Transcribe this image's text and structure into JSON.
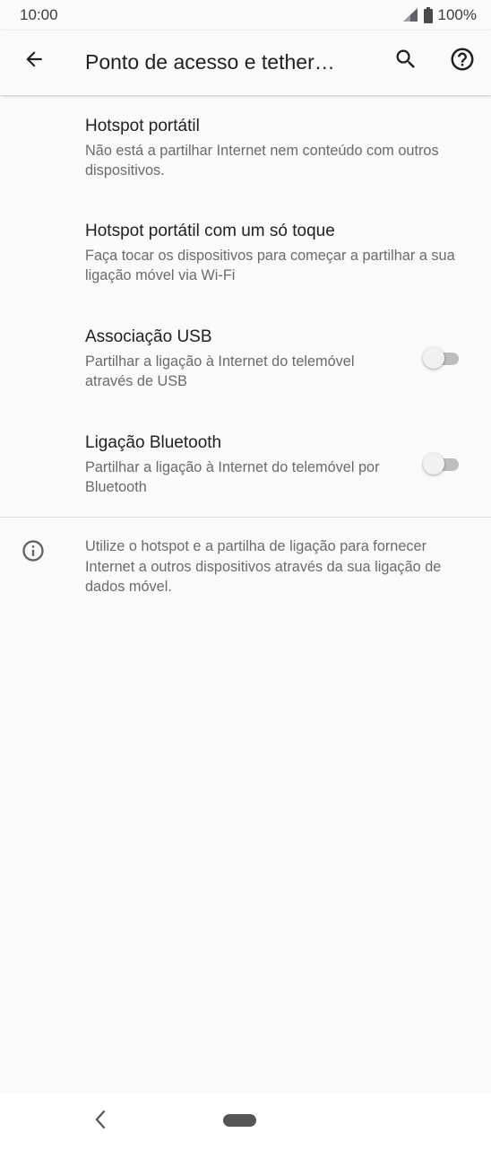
{
  "status_bar": {
    "time": "10:00",
    "battery": "100%",
    "icons": [
      "signal-icon",
      "battery-icon"
    ]
  },
  "app_bar": {
    "title": "Ponto de acesso e tether…",
    "icons": [
      "back-arrow-icon",
      "search-icon",
      "help-icon"
    ]
  },
  "settings": {
    "items": [
      {
        "title": "Hotspot portátil",
        "summary": "Não está a partilhar Internet nem conteúdo com outros dispositivos."
      },
      {
        "title": "Hotspot portátil com um só toque",
        "summary": "Faça tocar os dispositivos para começar a partilhar a sua ligação móvel via Wi-Fi"
      },
      {
        "title": "Associação USB",
        "summary": "Partilhar a ligação à Internet do telemóvel através de USB",
        "toggle_on": false
      },
      {
        "title": "Ligação Bluetooth",
        "summary": "Partilhar a ligação à Internet do telemóvel por Bluetooth",
        "toggle_on": false
      }
    ]
  },
  "footer": {
    "icon": "info-icon",
    "text": "Utilize o hotspot e a partilha de ligação para fornecer Internet a outros dispositivos através da sua ligação de dados móvel."
  },
  "nav_bar": {
    "icons": [
      "nav-back-icon",
      "home-pill"
    ]
  },
  "colors": {
    "background": "#fafafa",
    "title_text": "#202124",
    "summary_text": "#6b6b6b",
    "toggle_track_off": "#bdbdbd",
    "toggle_thumb_off": "#f1f1f1"
  }
}
